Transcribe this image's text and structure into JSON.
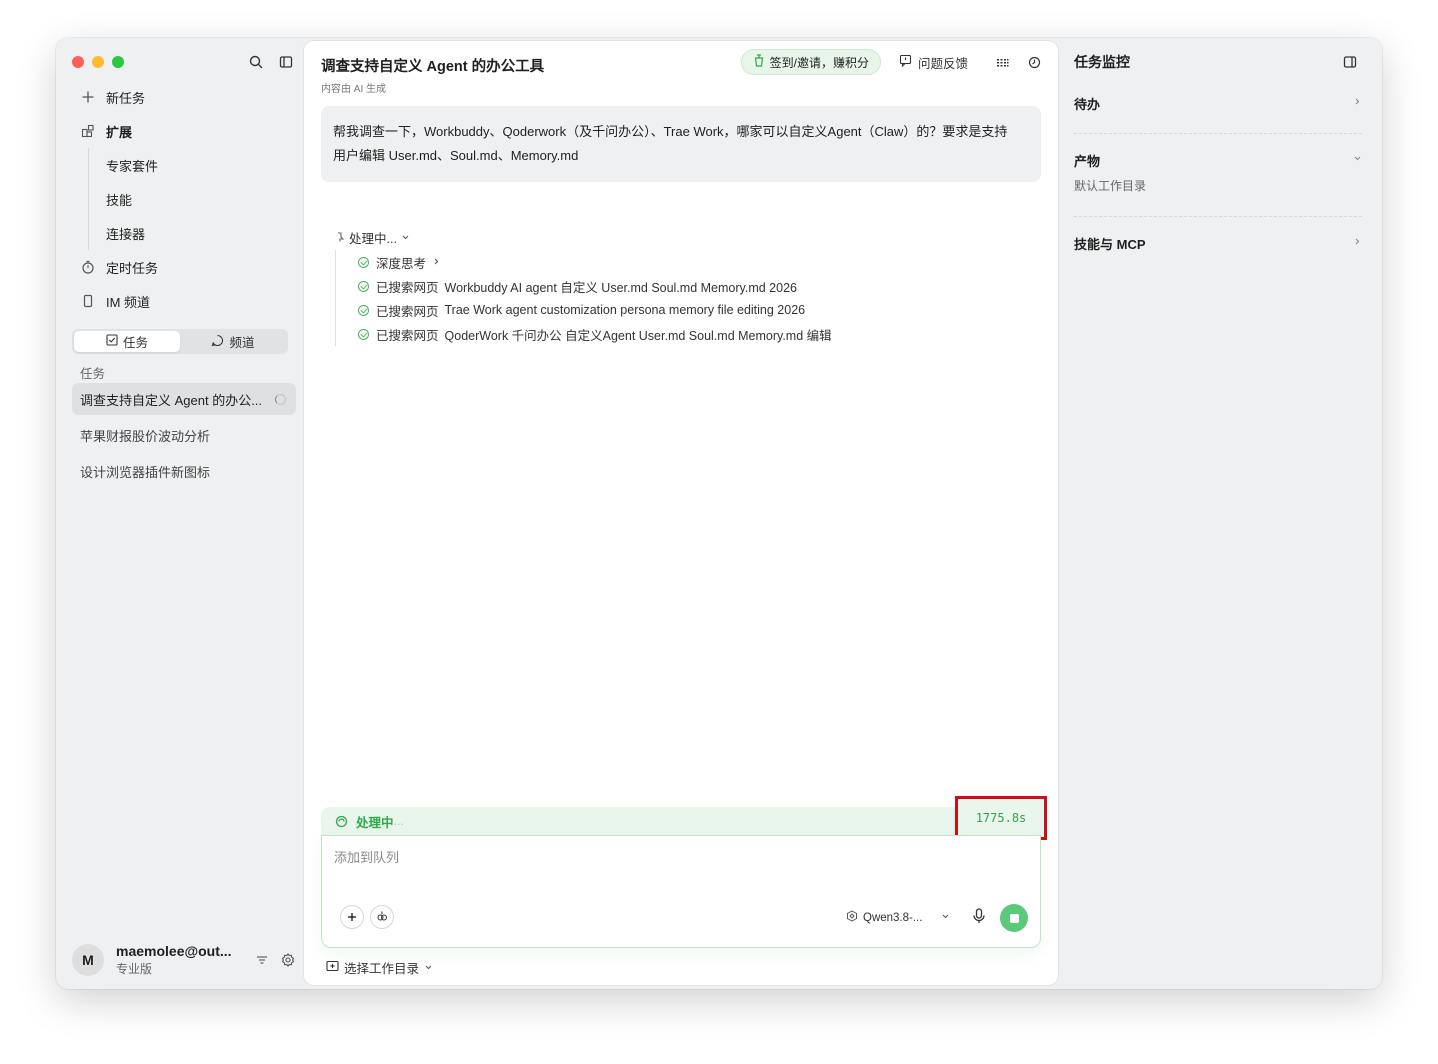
{
  "sidebar": {
    "new_task": "新任务",
    "extensions": "扩展",
    "ext_children": [
      "专家套件",
      "技能",
      "连接器"
    ],
    "scheduled": "定时任务",
    "im_channel": "IM 频道",
    "seg_tasks": "任务",
    "seg_channels": "频道",
    "section_label": "任务",
    "tasks": [
      {
        "title": "调查支持自定义 Agent 的办公..."
      },
      {
        "title": "苹果财报股价波动分析"
      },
      {
        "title": "设计浏览器插件新图标"
      }
    ],
    "user": {
      "initial": "M",
      "name": "maemolee@out...",
      "plan": "专业版"
    }
  },
  "main": {
    "title": "调查支持自定义 Agent 的办公工具",
    "subtitle": "内容由 AI 生成",
    "signin_label": "签到/邀请，赚积分",
    "feedback_label": "问题反馈",
    "prompt_line1": "帮我调查一下，Workbuddy、Qoderwork（及千问办公）、Trae Work，哪家可以自定义Agent（Claw）的？要求是支持",
    "prompt_line2": "用户编辑 User.md、Soul.md、Memory.md",
    "processing_label": "处理中...",
    "steps": [
      {
        "label": "深度思考",
        "query": ""
      },
      {
        "label": "已搜索网页",
        "query": "Workbuddy AI agent 自定义 User.md Soul.md Memory.md 2026"
      },
      {
        "label": "已搜索网页",
        "query": "Trae Work agent customization persona memory file editing 2026"
      },
      {
        "label": "已搜索网页",
        "query": "QoderWork 千问办公 自定义Agent User.md Soul.md Memory.md 编辑"
      }
    ],
    "status_text": "处理中",
    "status_dots": "...",
    "elapsed": "1775.8s",
    "composer_placeholder": "添加到队列",
    "model": "Qwen3.8-...",
    "workdir_label": "选择工作目录",
    "accent_color": "#2ea84a"
  },
  "right_panel": {
    "title": "任务监控",
    "todo": "待办",
    "artifacts": "产物",
    "artifacts_sub": "默认工作目录",
    "skills_mcp": "技能与 MCP"
  }
}
